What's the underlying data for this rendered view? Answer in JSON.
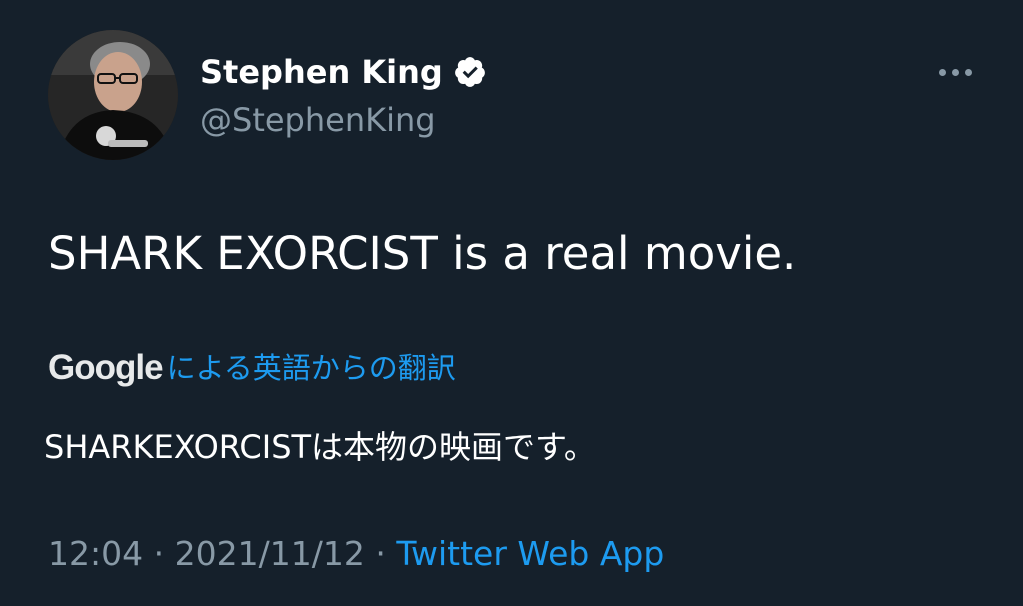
{
  "user": {
    "display_name": "Stephen King",
    "handle": "@StephenKing",
    "verified_icon": "verified-badge-icon",
    "avatar_icon": "profile-photo"
  },
  "more_menu": {
    "icon": "more-horizontal-icon"
  },
  "tweet": {
    "text": "SHARK EXORCIST is a real movie."
  },
  "translation": {
    "provider": "Google",
    "label": "による英語からの翻訳",
    "text": "SHARKEXORCISTは本物の映画です。"
  },
  "meta": {
    "time": "12:04",
    "separator": "·",
    "date": "2021/11/12",
    "source": "Twitter Web App"
  },
  "colors": {
    "background": "#15202b",
    "primary_text": "#ffffff",
    "secondary_text": "#8899a6",
    "link": "#1d9bf0"
  }
}
